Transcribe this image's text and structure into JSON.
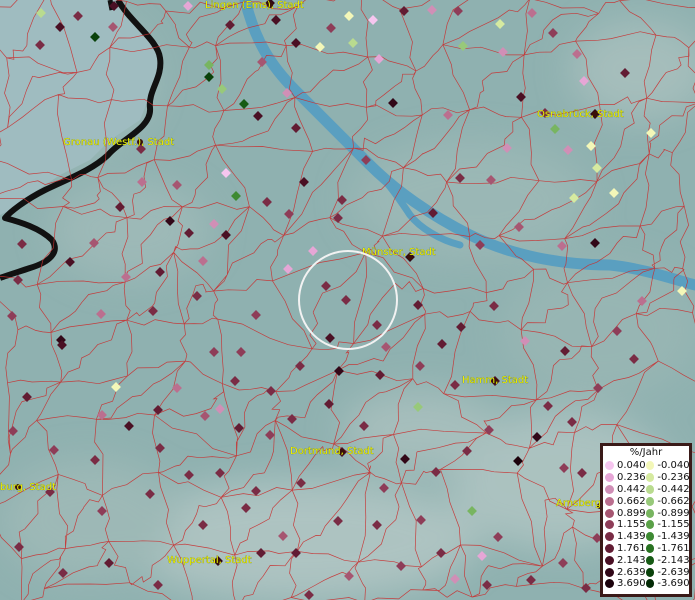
{
  "map": {
    "cities": [
      {
        "id": "lingen",
        "label": "Lingen (Ems), Stadt"
      },
      {
        "id": "osnabrueck",
        "label": "Osnabrück, Stadt"
      },
      {
        "id": "gronau",
        "label": "Gronau (Westf.), Stadt"
      },
      {
        "id": "muenster",
        "label": "Münster, Stadt"
      },
      {
        "id": "hamm",
        "label": "Hamm, Stadt"
      },
      {
        "id": "dortmund",
        "label": "Dortmund, Stadt"
      },
      {
        "id": "duisburg",
        "label": "burg, Stadt"
      },
      {
        "id": "arnsberg",
        "label": "Arnsberg"
      },
      {
        "id": "wuppertal",
        "label": "Wuppertal, Stadt"
      }
    ],
    "colors": {
      "background": "#8fb1b0",
      "river": "#5a9fc0",
      "district_border": "#c83030",
      "state_border": "#111111",
      "highlight_circle": "#f2f2f2"
    }
  },
  "legend": {
    "title": "%/Jahr",
    "positive": [
      {
        "value": "0.040",
        "color": "#f6c6ef"
      },
      {
        "value": "0.236",
        "color": "#e6a6d6"
      },
      {
        "value": "0.442",
        "color": "#d08fb6"
      },
      {
        "value": "0.662",
        "color": "#bb6f8f"
      },
      {
        "value": "0.899",
        "color": "#a65671"
      },
      {
        "value": "1.155",
        "color": "#8e3d58"
      },
      {
        "value": "1.439",
        "color": "#7a2c45"
      },
      {
        "value": "1.761",
        "color": "#621c33"
      },
      {
        "value": "2.143",
        "color": "#4a1024"
      },
      {
        "value": "2.639",
        "color": "#320818"
      },
      {
        "value": "3.690",
        "color": "#1c020c"
      }
    ],
    "negative": [
      {
        "value": "-0.040",
        "color": "#f3f7b8"
      },
      {
        "value": "-0.236",
        "color": "#d6eaa0"
      },
      {
        "value": "-0.442",
        "color": "#b9db8f"
      },
      {
        "value": "-0.662",
        "color": "#98c97a"
      },
      {
        "value": "-0.899",
        "color": "#78b560"
      },
      {
        "value": "-1.155",
        "color": "#5aa047"
      },
      {
        "value": "-1.439",
        "color": "#3e8a33"
      },
      {
        "value": "-1.761",
        "color": "#297222"
      },
      {
        "value": "-2.143",
        "color": "#175b15"
      },
      {
        "value": "-2.639",
        "color": "#0a420b"
      },
      {
        "value": "-3.690",
        "color": "#032a05"
      }
    ]
  }
}
